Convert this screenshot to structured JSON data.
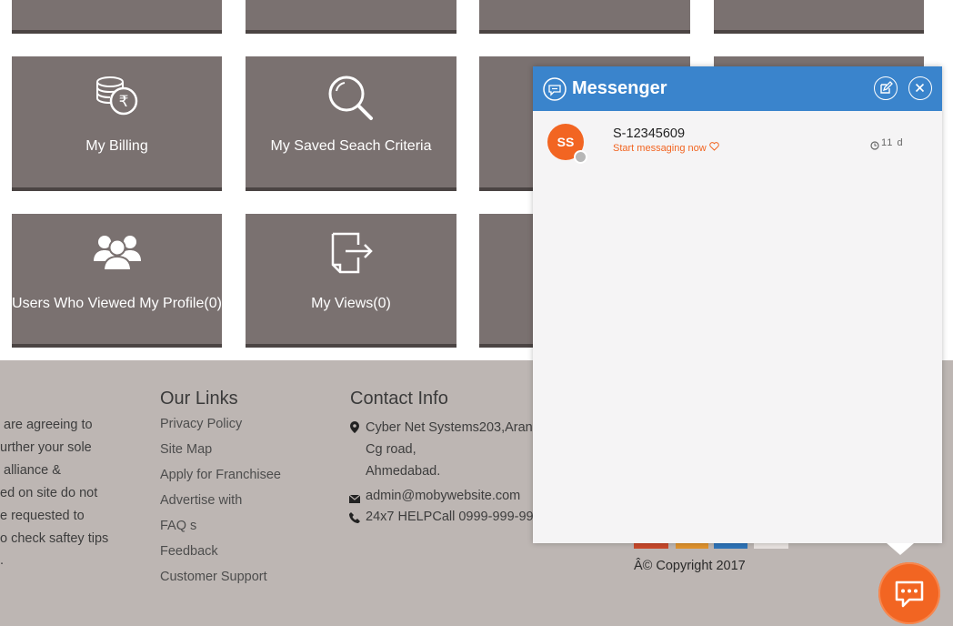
{
  "tiles": {
    "my_billing": "My Billing",
    "saved_search": "My Saved Seach Criteria",
    "viewed_profile": "Users Who Viewed My Profile(0)",
    "my_views": "My Views(0)"
  },
  "footer": {
    "about_lines": [
      "are agreeing to",
      "urther your sole",
      "alliance &",
      "ed on site do not",
      "e requested to",
      "o check saftey tips",
      "."
    ],
    "our_links_heading": "Our Links",
    "links": [
      "Privacy Policy",
      "Site Map",
      "Apply for Franchisee",
      "Advertise with",
      "FAQ s",
      "Feedback",
      "Customer Support"
    ],
    "contact_heading": "Contact Info",
    "address_lines": [
      "Cyber Net Systems203,Aran",
      "Cg road,",
      "Ahmedabad."
    ],
    "email": "admin@mobywebsite.com",
    "helpline": "24x7 HELPCall 0999-999-99",
    "copyright": "Â© Copyright 2017"
  },
  "messenger": {
    "title": "Messenger",
    "contact": {
      "initials": "SS",
      "name": "S-12345609",
      "subtitle": "Start messaging now",
      "time": "11 d"
    }
  },
  "colors": {
    "tile": "#7a7170",
    "footer": "#bdb6b3",
    "header": "#3a84cc",
    "accent": "#f26522"
  }
}
